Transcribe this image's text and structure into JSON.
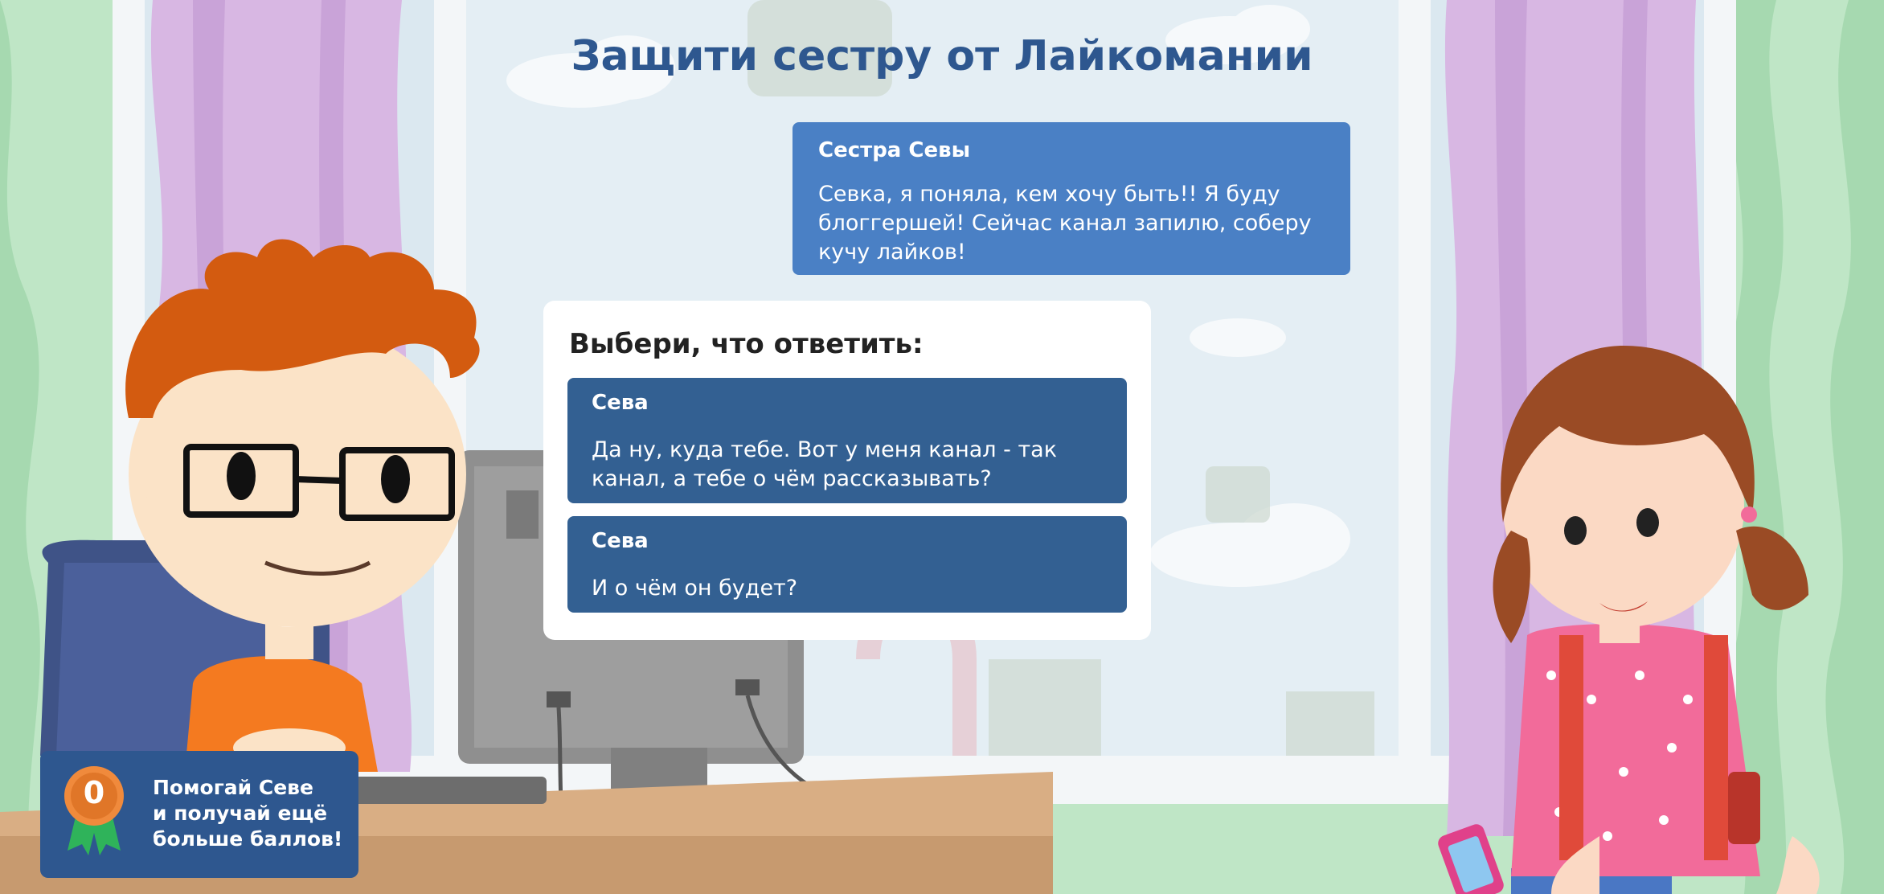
{
  "title": "Защити сестру от Лайкомании",
  "sister_message": {
    "speaker": "Сестра Севы",
    "text": "Севка, я поняла, кем хочу быть!! Я буду блоггершей! Сейчас канал запилю, соберу кучу лайков!"
  },
  "choice": {
    "header": "Выбери, что ответить:",
    "options": [
      {
        "speaker": "Сева",
        "text": "Да ну, куда тебе. Вот у меня канал - так канал, а тебе о чём рассказывать?"
      },
      {
        "speaker": "Сева",
        "text": "И о чём он будет?"
      }
    ]
  },
  "score": {
    "value": "0",
    "line1": "Помогай Севе",
    "line2": "и получай ещё",
    "line3": "больше баллов!"
  },
  "colors": {
    "title": "#2e578f",
    "sister_bubble": "#4a80c5",
    "option": "#336092",
    "score_box": "#2e578f",
    "medal": "#f08a3c"
  }
}
